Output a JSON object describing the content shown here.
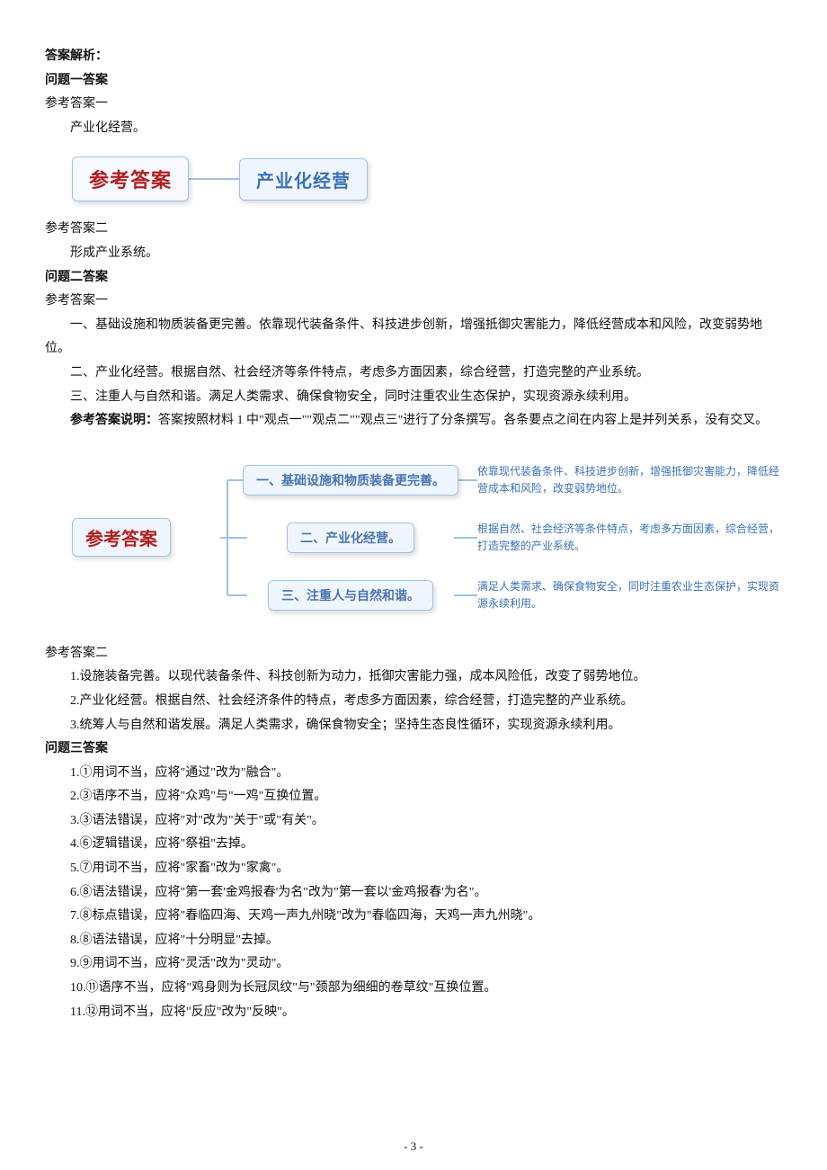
{
  "header": {
    "title": "答案解析：",
    "q1_title": "问题一答案",
    "q1_ref1": "参考答案一",
    "q1_ref1_body": "产业化经营。",
    "graphic1_left": "参考答案",
    "graphic1_right": "产业化经营",
    "q1_ref2": "参考答案二",
    "q1_ref2_body": "形成产业系统。"
  },
  "q2": {
    "title": "问题二答案",
    "ref1": "参考答案一",
    "p1": "一、基础设施和物质装备更完善。依靠现代装备条件、科技进步创新，增强抵御灾害能力，降低经营成本和风险，改变弱势地位。",
    "p2": "二、产业化经营。根据自然、社会经济等条件特点，考虑多方面因素，综合经营，打造完整的产业系统。",
    "p3": "三、注重人与自然和谐。满足人类需求、确保食物安全，同时注重农业生态保护，实现资源永续利用。",
    "note_label": "参考答案说明：",
    "note_body": "答案按照材料 1 中\"观点一\"\"观点二\"\"观点三\"进行了分条撰写。各条要点之间在内容上是并列关系，没有交叉。",
    "graphic2": {
      "root": "参考答案",
      "items": [
        {
          "title": "一、基础设施和物质装备更完善。",
          "desc": "依靠现代装备条件、科技进步创新，增强抵御灾害能力，降低经营成本和风险，改变弱势地位。"
        },
        {
          "title": "二、产业化经营。",
          "desc": "根据自然、社会经济等条件特点，考虑多方面因素，综合经营，打造完整的产业系统。"
        },
        {
          "title": "三、注重人与自然和谐。",
          "desc": "满足人类需求、确保食物安全，同时注重农业生态保护，实现资源永续利用。"
        }
      ]
    },
    "ref2": "参考答案二",
    "r2_1": "1.设施装备完善。以现代装备条件、科技创新为动力，抵御灾害能力强，成本风险低，改变了弱势地位。",
    "r2_2": "2.产业化经营。根据自然、社会经济条件的特点，考虑多方面因素，综合经营，打造完整的产业系统。",
    "r2_3": "3.统筹人与自然和谐发展。满足人类需求，确保食物安全；坚持生态良性循环，实现资源永续利用。"
  },
  "q3": {
    "title": "问题三答案",
    "items": [
      "1.①用词不当，应将\"通过\"改为\"融合\"。",
      "2.③语序不当，应将\"众鸡\"与\"一鸡\"互换位置。",
      "3.③语法错误，应将\"对\"改为\"关于\"或\"有关\"。",
      "4.⑥逻辑错误，应将\"祭祖\"去掉。",
      "5.⑦用词不当，应将\"家畜\"改为\"家禽\"。",
      "6.⑧语法错误，应将\"第一套'金鸡报春'为名\"改为\"第一套以'金鸡报春'为名\"。",
      "7.⑧标点错误，应将\"春临四海、天鸡一声九州晓\"改为\"春临四海，天鸡一声九州晓\"。",
      "8.⑧语法错误，应将\"十分明显\"去掉。",
      "9.⑨用词不当，应将\"灵活\"改为\"灵动\"。",
      "10.⑪语序不当，应将\"鸡身则为长冠凤纹\"与\"颈部为细细的卷草纹\"互换位置。",
      "11.⑫用词不当，应将\"反应\"改为\"反映\"。"
    ]
  },
  "page_number": "- 3 -"
}
